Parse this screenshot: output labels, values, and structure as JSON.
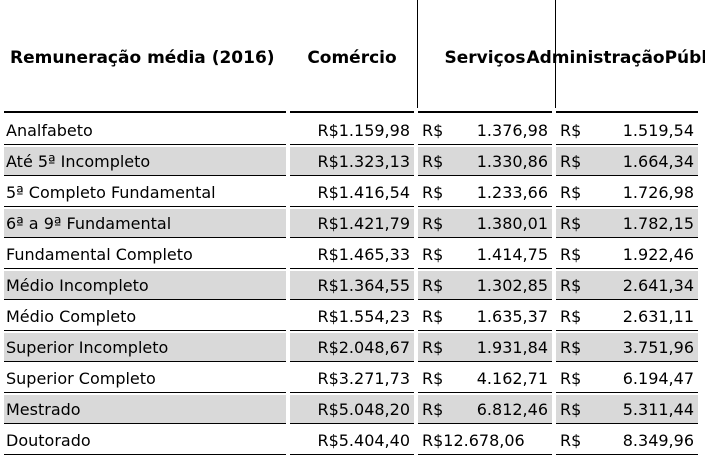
{
  "header": {
    "label": "Remuneração média (2016)",
    "comercio": "Comércio",
    "servicos": "Serviços",
    "administracao_line1": "Administração",
    "administracao_line2": "Pública"
  },
  "currency": "R$",
  "rows": [
    {
      "label": "Analfabeto",
      "comercio": "R$1.159,98",
      "servicos": "1.376,98",
      "administracao": "1.519,54",
      "shaded": false
    },
    {
      "label": "Até 5ª Incompleto",
      "comercio": "R$1.323,13",
      "servicos": "1.330,86",
      "administracao": "1.664,34",
      "shaded": true
    },
    {
      "label": "5ª Completo Fundamental",
      "comercio": "R$1.416,54",
      "servicos": "1.233,66",
      "administracao": "1.726,98",
      "shaded": false
    },
    {
      "label": "6ª a 9ª Fundamental",
      "comercio": "R$1.421,79",
      "servicos": "1.380,01",
      "administracao": "1.782,15",
      "shaded": true
    },
    {
      "label": "Fundamental Completo",
      "comercio": "R$1.465,33",
      "servicos": "1.414,75",
      "administracao": "1.922,46",
      "shaded": false
    },
    {
      "label": "Médio Incompleto",
      "comercio": "R$1.364,55",
      "servicos": "1.302,85",
      "administracao": "2.641,34",
      "shaded": true
    },
    {
      "label": "Médio Completo",
      "comercio": "R$1.554,23",
      "servicos": "1.635,37",
      "administracao": "2.631,11",
      "shaded": false
    },
    {
      "label": "Superior Incompleto",
      "comercio": "R$2.048,67",
      "servicos": "1.931,84",
      "administracao": "3.751,96",
      "shaded": true
    },
    {
      "label": "Superior Completo",
      "comercio": "R$3.271,73",
      "servicos": "4.162,71",
      "administracao": "6.194,47",
      "shaded": false
    },
    {
      "label": "Mestrado",
      "comercio": "R$5.048,20",
      "servicos": "6.812,46",
      "administracao": "5.311,44",
      "shaded": true
    },
    {
      "label": "Doutorado",
      "comercio": "R$5.404,40",
      "servicos": "12.678,06",
      "administracao": "8.349,96",
      "shaded": false
    }
  ]
}
